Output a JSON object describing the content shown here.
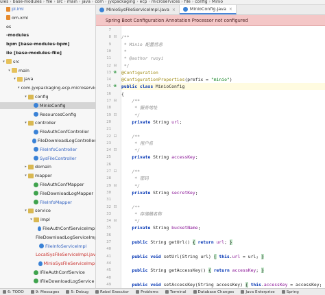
{
  "breadcrumb": [
    "ules",
    "base-modules",
    "file",
    "src",
    "main",
    "java",
    "com",
    "jyxpackaging",
    "ecp",
    "microservices",
    "file",
    "config",
    "Minio"
  ],
  "sidebar": {
    "items": [
      {
        "label": "pl.iml",
        "icon": "xml-icon",
        "indent": 0,
        "color": "blue"
      },
      {
        "label": "om.xml",
        "icon": "xml-icon",
        "indent": 0
      },
      {
        "label": "es",
        "icon": "none",
        "indent": 0
      },
      {
        "label": "-modules",
        "icon": "none",
        "indent": 0,
        "bold": true
      },
      {
        "label": "bpm [base-modules-bpm]",
        "icon": "none",
        "indent": 0,
        "bold": true
      },
      {
        "label": "ile [base-modules-file]",
        "icon": "none",
        "indent": 0,
        "bold": true
      },
      {
        "label": "src",
        "icon": "folder-icon",
        "indent": 0,
        "arrow": "▾"
      },
      {
        "label": "main",
        "icon": "folder-icon",
        "indent": 1,
        "arrow": "▾"
      },
      {
        "label": "java",
        "icon": "folder-icon",
        "indent": 2,
        "arrow": "▾"
      },
      {
        "label": "com.jyxpackaging.ecp.microservices.file",
        "icon": "package-icon",
        "indent": 3,
        "arrow": "▾"
      },
      {
        "label": "config",
        "icon": "package-icon",
        "indent": 4,
        "arrow": "▾"
      },
      {
        "label": "MinioConfig",
        "icon": "class-icon",
        "indent": 5,
        "selected": true
      },
      {
        "label": "ResourcesConfig",
        "icon": "class-icon",
        "indent": 5
      },
      {
        "label": "controller",
        "icon": "package-icon",
        "indent": 4,
        "arrow": "▾"
      },
      {
        "label": "FileAuthConfController",
        "icon": "class-icon",
        "indent": 5
      },
      {
        "label": "FileDownloadLogController",
        "icon": "class-icon",
        "indent": 5
      },
      {
        "label": "FileInfoController",
        "icon": "class-icon",
        "indent": 5,
        "color": "blue"
      },
      {
        "label": "SysFileController",
        "icon": "class-icon",
        "indent": 5,
        "color": "blue"
      },
      {
        "label": "domain",
        "icon": "package-icon",
        "indent": 4,
        "arrow": "▸"
      },
      {
        "label": "mapper",
        "icon": "package-icon",
        "indent": 4,
        "arrow": "▾"
      },
      {
        "label": "FileAuthConfMapper",
        "icon": "interface-icon",
        "indent": 5
      },
      {
        "label": "FileDownloadLogMapper",
        "icon": "interface-icon",
        "indent": 5
      },
      {
        "label": "FileInfoMapper",
        "icon": "interface-icon",
        "indent": 5,
        "color": "blue"
      },
      {
        "label": "service",
        "icon": "package-icon",
        "indent": 4,
        "arrow": "▾"
      },
      {
        "label": "impl",
        "icon": "package-icon",
        "indent": 5,
        "arrow": "▾"
      },
      {
        "label": "FileAuthConfServiceImpl",
        "icon": "class-icon",
        "indent": 6
      },
      {
        "label": "FileDownloadLogServiceImpl",
        "icon": "class-icon",
        "indent": 6
      },
      {
        "label": "FileInfoServiceImpl",
        "icon": "class-icon",
        "indent": 6,
        "color": "blue"
      },
      {
        "label": "LocalSysFileServiceImpl.java",
        "icon": "class-icon",
        "indent": 6,
        "color": "red"
      },
      {
        "label": "MinioSysFileServiceImpl",
        "icon": "class-icon",
        "indent": 6,
        "color": "red"
      },
      {
        "label": "IFileAuthConfService",
        "icon": "interface-icon",
        "indent": 5
      },
      {
        "label": "IFileDownloadLogService",
        "icon": "interface-icon",
        "indent": 5
      }
    ]
  },
  "tabs": [
    {
      "label": "MinioSysFileServiceImpl.java",
      "active": false,
      "close": "×"
    },
    {
      "label": "MinioConfig.java",
      "active": true,
      "close": "×"
    }
  ],
  "banner": {
    "text": "Spring Boot Configuration Annotation Processor not configured"
  },
  "code": {
    "lines": [
      {
        "n": "7",
        "parts": []
      },
      {
        "n": "8",
        "parts": [
          {
            "c": "cmt",
            "t": "/**"
          }
        ],
        "mark": "fold"
      },
      {
        "n": "9",
        "parts": [
          {
            "c": "cmt",
            "t": " * Minio 配置信息"
          }
        ]
      },
      {
        "n": "10",
        "parts": [
          {
            "c": "cmt",
            "t": " *"
          }
        ]
      },
      {
        "n": "11",
        "parts": [
          {
            "c": "cmt",
            "t": " * @author ruoyi"
          }
        ]
      },
      {
        "n": "12",
        "parts": [
          {
            "c": "cmt",
            "t": " */"
          }
        ],
        "mark": "fold"
      },
      {
        "n": "13",
        "parts": [
          {
            "c": "ann",
            "t": "@Configuration"
          }
        ],
        "mark": "bean"
      },
      {
        "n": "14",
        "parts": [
          {
            "c": "ann",
            "t": "@ConfigurationProperties"
          },
          {
            "c": "",
            "t": "(prefix = "
          },
          {
            "c": "str",
            "t": "\"minio\""
          },
          {
            "c": "",
            "t": ")"
          }
        ]
      },
      {
        "n": "15",
        "parts": [
          {
            "c": "kw",
            "t": "public class "
          },
          {
            "c": "",
            "t": "MinioConfig"
          }
        ],
        "mark": "bean",
        "hl": true
      },
      {
        "n": "16",
        "parts": [
          {
            "c": "",
            "t": "{"
          }
        ]
      },
      {
        "n": "17",
        "parts": [
          {
            "c": "cmt",
            "t": "    /**"
          }
        ],
        "mark": "fold"
      },
      {
        "n": "18",
        "parts": [
          {
            "c": "cmt",
            "t": "     * 服务地址"
          }
        ]
      },
      {
        "n": "19",
        "parts": [
          {
            "c": "cmt",
            "t": "     */"
          }
        ],
        "mark": "fold"
      },
      {
        "n": "20",
        "parts": [
          {
            "c": "kw",
            "t": "    private "
          },
          {
            "c": "",
            "t": "String "
          },
          {
            "c": "fld",
            "t": "url"
          },
          {
            "c": "",
            "t": ";"
          }
        ]
      },
      {
        "n": "21",
        "parts": []
      },
      {
        "n": "22",
        "parts": [
          {
            "c": "cmt",
            "t": "    /**"
          }
        ],
        "mark": "fold"
      },
      {
        "n": "23",
        "parts": [
          {
            "c": "cmt",
            "t": "     * 用户名"
          }
        ]
      },
      {
        "n": "24",
        "parts": [
          {
            "c": "cmt",
            "t": "     */"
          }
        ],
        "mark": "fold"
      },
      {
        "n": "25",
        "parts": [
          {
            "c": "kw",
            "t": "    private "
          },
          {
            "c": "",
            "t": "String "
          },
          {
            "c": "fld",
            "t": "accessKey"
          },
          {
            "c": "",
            "t": ";"
          }
        ]
      },
      {
        "n": "26",
        "parts": []
      },
      {
        "n": "27",
        "parts": [
          {
            "c": "cmt",
            "t": "    /**"
          }
        ],
        "mark": "fold"
      },
      {
        "n": "28",
        "parts": [
          {
            "c": "cmt",
            "t": "     * 密码"
          }
        ]
      },
      {
        "n": "29",
        "parts": [
          {
            "c": "cmt",
            "t": "     */"
          }
        ],
        "mark": "fold"
      },
      {
        "n": "30",
        "parts": [
          {
            "c": "kw",
            "t": "    private "
          },
          {
            "c": "",
            "t": "String "
          },
          {
            "c": "fld",
            "t": "secretKey"
          },
          {
            "c": "",
            "t": ";"
          }
        ]
      },
      {
        "n": "31",
        "parts": []
      },
      {
        "n": "32",
        "parts": [
          {
            "c": "cmt",
            "t": "    /**"
          }
        ],
        "mark": "fold"
      },
      {
        "n": "33",
        "parts": [
          {
            "c": "cmt",
            "t": "     * 存储桶名称"
          }
        ]
      },
      {
        "n": "34",
        "parts": [
          {
            "c": "cmt",
            "t": "     */"
          }
        ],
        "mark": "fold"
      },
      {
        "n": "35",
        "parts": [
          {
            "c": "kw",
            "t": "    private "
          },
          {
            "c": "",
            "t": "String "
          },
          {
            "c": "fld",
            "t": "bucketName"
          },
          {
            "c": "",
            "t": ";"
          }
        ]
      },
      {
        "n": "36",
        "parts": []
      },
      {
        "n": "37",
        "parts": [
          {
            "c": "kw",
            "t": "    public "
          },
          {
            "c": "",
            "t": "String getUrl() "
          },
          {
            "c": "brace",
            "t": "{"
          },
          {
            "c": "",
            "t": " "
          },
          {
            "c": "kw",
            "t": "return "
          },
          {
            "c": "fld",
            "t": "url"
          },
          {
            "c": "",
            "t": "; "
          },
          {
            "c": "brace",
            "t": "}"
          }
        ]
      },
      {
        "n": "40",
        "parts": []
      },
      {
        "n": "41",
        "parts": [
          {
            "c": "kw",
            "t": "    public void "
          },
          {
            "c": "",
            "t": "setUrl(String url) "
          },
          {
            "c": "brace",
            "t": "{"
          },
          {
            "c": "",
            "t": " "
          },
          {
            "c": "kw",
            "t": "this"
          },
          {
            "c": "",
            "t": "."
          },
          {
            "c": "fld",
            "t": "url"
          },
          {
            "c": "",
            "t": " = url; "
          },
          {
            "c": "brace",
            "t": "}"
          }
        ]
      },
      {
        "n": "44",
        "parts": []
      },
      {
        "n": "45",
        "parts": [
          {
            "c": "kw",
            "t": "    public "
          },
          {
            "c": "",
            "t": "String getAccessKey() "
          },
          {
            "c": "brace",
            "t": "{"
          },
          {
            "c": "",
            "t": " "
          },
          {
            "c": "kw",
            "t": "return "
          },
          {
            "c": "fld",
            "t": "accessKey"
          },
          {
            "c": "",
            "t": "; "
          },
          {
            "c": "brace",
            "t": "}"
          }
        ]
      },
      {
        "n": "48",
        "parts": []
      },
      {
        "n": "49",
        "parts": [
          {
            "c": "kw",
            "t": "    public void "
          },
          {
            "c": "",
            "t": "setAccessKey(String accessKey) "
          },
          {
            "c": "brace",
            "t": "{"
          },
          {
            "c": "",
            "t": " "
          },
          {
            "c": "kw",
            "t": "this"
          },
          {
            "c": "",
            "t": "."
          },
          {
            "c": "fld",
            "t": "accessKey"
          },
          {
            "c": "",
            "t": " = accessKey;"
          }
        ]
      },
      {
        "n": "52",
        "parts": []
      },
      {
        "n": "53",
        "parts": [
          {
            "c": "kw",
            "t": "    public "
          },
          {
            "c": "",
            "t": "String getSecretKey() "
          },
          {
            "c": "brace",
            "t": "{"
          },
          {
            "c": "",
            "t": " "
          },
          {
            "c": "kw",
            "t": "return "
          },
          {
            "c": "fld",
            "t": "secretKey"
          },
          {
            "c": "",
            "t": "; "
          },
          {
            "c": "brace",
            "t": "}"
          }
        ]
      }
    ]
  },
  "bottombar": {
    "items": [
      "6: TODO",
      "9: Messages",
      "5: Debug",
      "Rebel Executor",
      "Problems",
      "Terminal",
      "Database Changes",
      "Java Enterprise",
      "Spring"
    ]
  },
  "colors": {
    "banner_bg": "#f4c7c7",
    "selected_row": "#d5d5d5",
    "keyword": "#0033b3",
    "annotation": "#9e880d",
    "string": "#067d17",
    "field": "#871094"
  }
}
